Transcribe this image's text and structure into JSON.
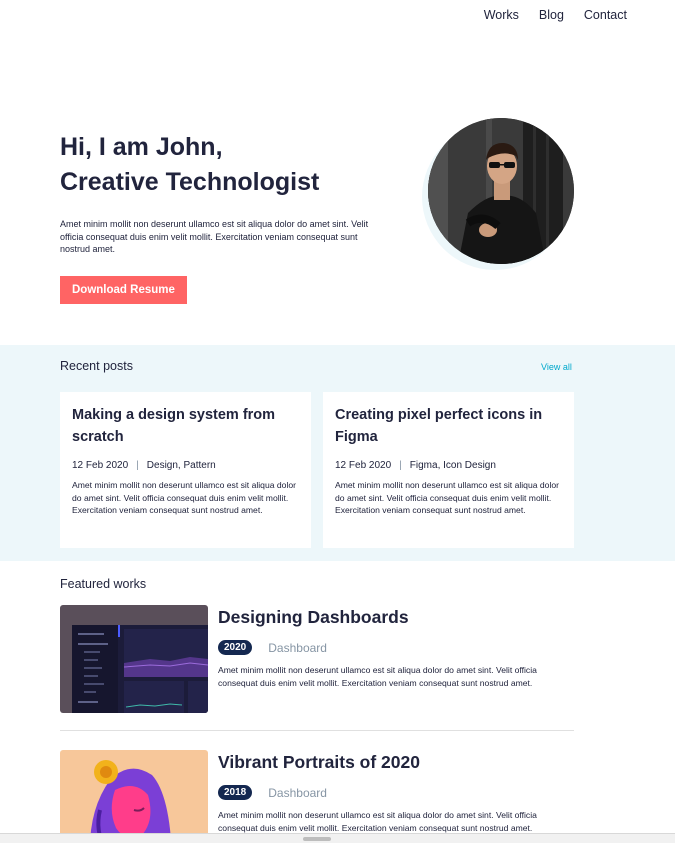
{
  "nav": {
    "items": [
      "Works",
      "Blog",
      "Contact"
    ]
  },
  "hero": {
    "title_line1": "Hi, I am John,",
    "title_line2": "Creative Technologist",
    "description": "Amet minim mollit non deserunt ullamco est sit aliqua dolor do amet sint. Velit officia consequat duis enim velit mollit. Exercitation veniam consequat sunt nostrud amet.",
    "button_label": "Download Resume"
  },
  "recent": {
    "title": "Recent posts",
    "view_all": "View all",
    "posts": [
      {
        "title": "Making a design system from scratch",
        "date": "12 Feb 2020",
        "sep": "|",
        "tags": "Design, Pattern",
        "excerpt": "Amet minim mollit non deserunt ullamco est sit aliqua dolor do amet sint. Velit officia consequat duis enim velit mollit. Exercitation veniam consequat sunt nostrud amet."
      },
      {
        "title": "Creating pixel perfect icons in Figma",
        "date": "12 Feb 2020",
        "sep": "|",
        "tags": "Figma, Icon Design",
        "excerpt": "Amet minim mollit non deserunt ullamco est sit aliqua dolor do amet sint. Velit officia consequat duis enim velit mollit. Exercitation veniam consequat sunt nostrud amet."
      }
    ]
  },
  "featured": {
    "title": "Featured works",
    "works": [
      {
        "title": "Designing Dashboards",
        "year": "2020",
        "category": "Dashboard",
        "description": "Amet minim mollit non deserunt ullamco est sit aliqua dolor do amet sint. Velit officia consequat duis enim velit mollit. Exercitation veniam consequat sunt nostrud amet."
      },
      {
        "title": "Vibrant Portraits of 2020",
        "year": "2018",
        "category": "Dashboard",
        "description": "Amet minim mollit non deserunt ullamco est sit aliqua dolor do amet sint. Velit officia consequat duis enim velit mollit. Exercitation veniam consequat sunt nostrud amet."
      }
    ]
  },
  "colors": {
    "accent": "#FF6464",
    "text": "#21243D",
    "section_bg": "#EDF7FA",
    "link": "#00A8CC",
    "badge": "#142850",
    "muted": "#8695A4"
  }
}
